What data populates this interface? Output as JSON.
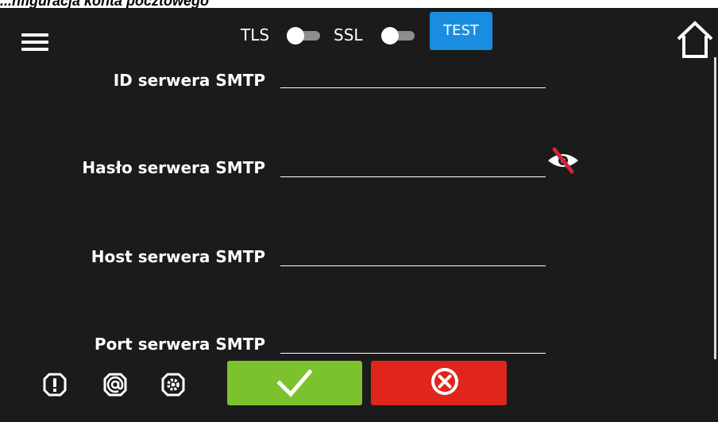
{
  "caption": "...nfiguracja konta pocztowego",
  "header": {
    "tls_label": "TLS",
    "ssl_label": "SSL",
    "test_label": "TEST",
    "tls_enabled": false,
    "ssl_enabled": false
  },
  "fields": {
    "smtp_id_label": "ID serwera SMTP",
    "smtp_id_value": "",
    "smtp_password_label": "Hasło serwera SMTP",
    "smtp_password_value": "",
    "smtp_host_label": "Host serwera SMTP",
    "smtp_host_value": "",
    "smtp_port_label": "Port serwera SMTP",
    "smtp_port_value": ""
  },
  "icons": {
    "menu": "hamburger-menu-icon",
    "home": "home-icon",
    "eye": "eye-slash-icon",
    "alarm": "alarm-icon",
    "email": "email-at-icon",
    "settings": "settings-gear-icon",
    "confirm": "checkmark-icon",
    "cancel": "cancel-x-icon"
  },
  "colors": {
    "background": "#1b1b1b",
    "test_button": "#1a8de0",
    "confirm_button": "#7cc22e",
    "cancel_button": "#e0251c",
    "eye_slash": "#d0243a"
  }
}
